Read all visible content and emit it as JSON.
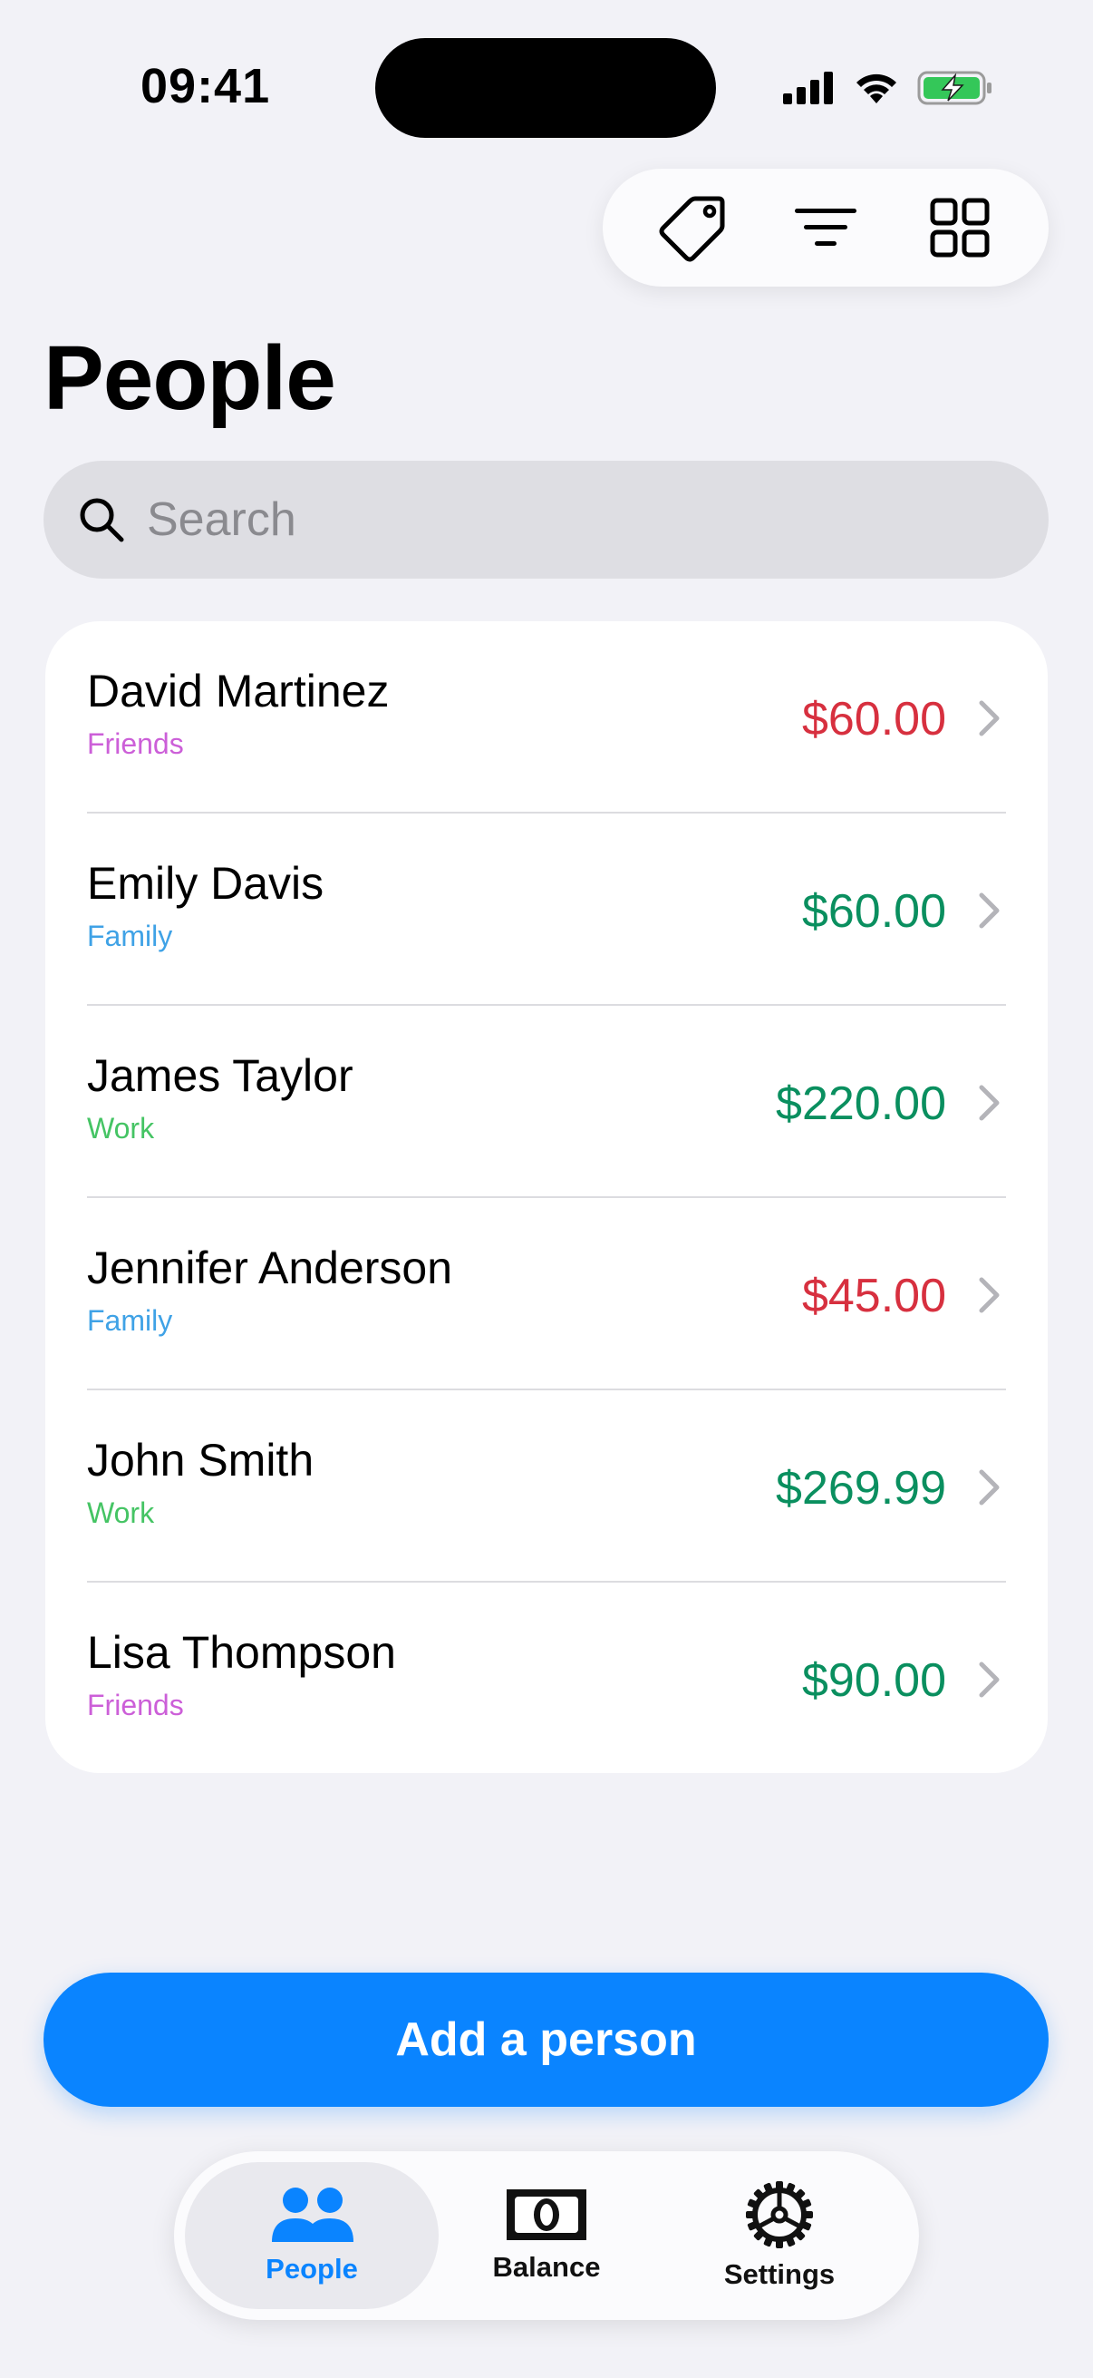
{
  "status": {
    "time": "09:41"
  },
  "toolbar": {
    "tag_icon": "tag-icon",
    "filter_icon": "filter-icon",
    "grid_icon": "grid-icon"
  },
  "header": {
    "title": "People"
  },
  "search": {
    "placeholder": "Search",
    "value": ""
  },
  "people": [
    {
      "name": "David Martinez",
      "group": "Friends",
      "amount": "$60.00",
      "amount_color": "#d7303f",
      "group_color": "#cc5fd8"
    },
    {
      "name": "Emily Davis",
      "group": "Family",
      "amount": "$60.00",
      "amount_color": "#0a8f5f",
      "group_color": "#3fa2e6"
    },
    {
      "name": "James Taylor",
      "group": "Work",
      "amount": "$220.00",
      "amount_color": "#0a8f5f",
      "group_color": "#45c464"
    },
    {
      "name": "Jennifer Anderson",
      "group": "Family",
      "amount": "$45.00",
      "amount_color": "#d7303f",
      "group_color": "#3fa2e6"
    },
    {
      "name": "John Smith",
      "group": "Work",
      "amount": "$269.99",
      "amount_color": "#0a8f5f",
      "group_color": "#45c464"
    },
    {
      "name": "Lisa Thompson",
      "group": "Friends",
      "amount": "$90.00",
      "amount_color": "#0a8f5f",
      "group_color": "#cc5fd8"
    }
  ],
  "actions": {
    "add_label": "Add a person"
  },
  "tabs": [
    {
      "label": "People",
      "icon": "people-icon",
      "active": true
    },
    {
      "label": "Balance",
      "icon": "banknote-icon",
      "active": false
    },
    {
      "label": "Settings",
      "icon": "gear-icon",
      "active": false
    }
  ],
  "colors": {
    "accent": "#0a84ff",
    "negative": "#d7303f",
    "positive": "#0a8f5f"
  }
}
